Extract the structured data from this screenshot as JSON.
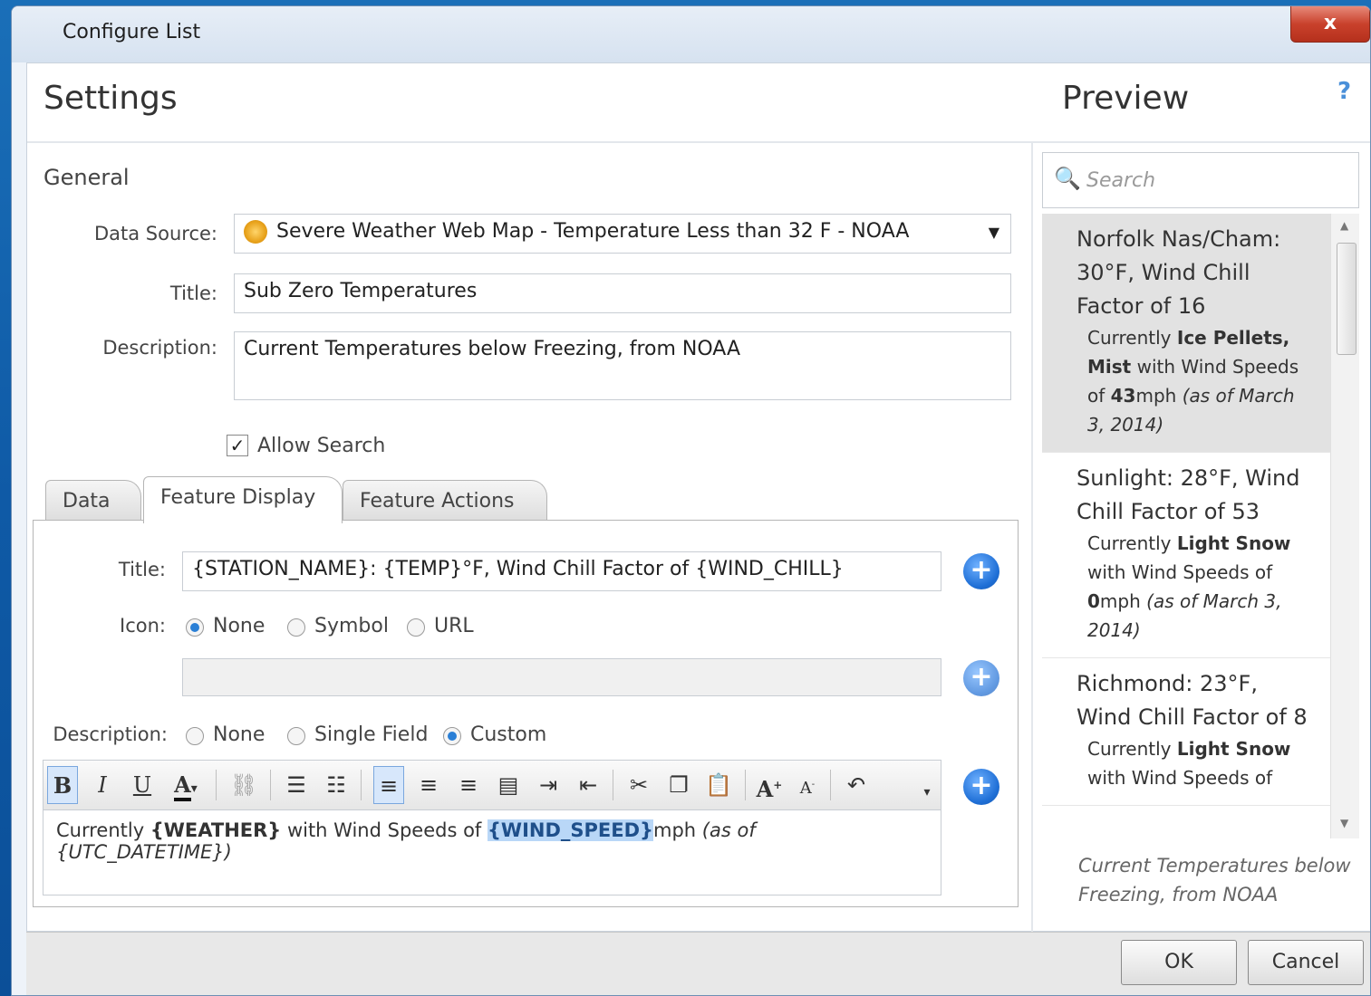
{
  "window": {
    "title": "Configure List",
    "close_label": "x"
  },
  "headings": {
    "settings": "Settings",
    "preview": "Preview",
    "help": "?"
  },
  "general": {
    "section_label": "General",
    "data_source_label": "Data Source:",
    "data_source_value": "Severe Weather Web Map - Temperature Less than 32 F - NOAA",
    "title_label": "Title:",
    "title_value": "Sub Zero Temperatures",
    "description_label": "Description:",
    "description_value": "Current Temperatures below Freezing, from NOAA",
    "allow_search_label": "Allow Search",
    "allow_search_checked": true
  },
  "tabs": [
    {
      "label": "Data",
      "active": false
    },
    {
      "label": "Feature Display",
      "active": true
    },
    {
      "label": "Feature Actions",
      "active": false
    }
  ],
  "feature_display": {
    "title_label": "Title:",
    "title_value": "{STATION_NAME}: {TEMP}°F, Wind Chill Factor of {WIND_CHILL}",
    "icon_label": "Icon:",
    "icon_options": [
      "None",
      "Symbol",
      "URL"
    ],
    "icon_selected": "None",
    "description_label": "Description:",
    "description_options": [
      "None",
      "Single Field",
      "Custom"
    ],
    "description_selected": "Custom",
    "editor": {
      "t1": "Currently ",
      "t2": "{WEATHER}",
      "t3": " with Wind Speeds of ",
      "t4": "{WIND_SPEED}",
      "t5": "mph ",
      "t6": "(as of {UTC_DATETIME})"
    }
  },
  "toolbar_icons": [
    "bold-icon",
    "italic-icon",
    "underline-icon",
    "font-color-icon",
    "link-icon",
    "bullet-list-icon",
    "numbered-list-icon",
    "align-left-icon",
    "align-center-icon",
    "align-right-icon",
    "justify-icon",
    "indent-icon",
    "outdent-icon",
    "cut-icon",
    "copy-icon",
    "paste-icon",
    "increase-font-icon",
    "decrease-font-icon",
    "undo-icon"
  ],
  "preview": {
    "search_placeholder": "Search",
    "items": [
      {
        "title": "Norfolk Nas/Cham: 30°F, Wind Chill Factor of 16",
        "d1": "Currently ",
        "d2": "Ice Pellets, Mist",
        "d3": " with Wind Speeds of ",
        "d4": "43",
        "d5": "mph ",
        "d6": "(as of March 3, 2014)",
        "selected": true
      },
      {
        "title": "Sunlight: 28°F, Wind Chill Factor of 53",
        "d1": "Currently ",
        "d2": "Light Snow",
        "d3": " with Wind Speeds of ",
        "d4": "0",
        "d5": "mph ",
        "d6": "(as of March 3, 2014)",
        "selected": false
      },
      {
        "title": "Richmond: 23°F, Wind Chill Factor of 8",
        "d1": "Currently ",
        "d2": "Light Snow",
        "d3": " with Wind Speeds of",
        "d4": "",
        "d5": "",
        "d6": "",
        "selected": false
      }
    ],
    "description": "Current Temperatures below Freezing, from NOAA"
  },
  "footer": {
    "ok_label": "OK",
    "cancel_label": "Cancel"
  },
  "colors": {
    "accent": "#2a7fd6",
    "close": "#c9412c",
    "selected_row": "#e2e2e2"
  }
}
